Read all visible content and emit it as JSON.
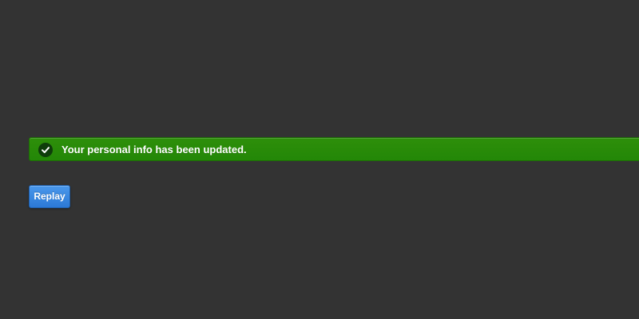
{
  "alert": {
    "type": "success",
    "icon": "check-circle-icon",
    "message": "Your personal info has been updated.",
    "color": "#268a08"
  },
  "actions": {
    "replay_label": "Replay",
    "replay_color": "#3a88e2"
  },
  "background_color": "#333333"
}
